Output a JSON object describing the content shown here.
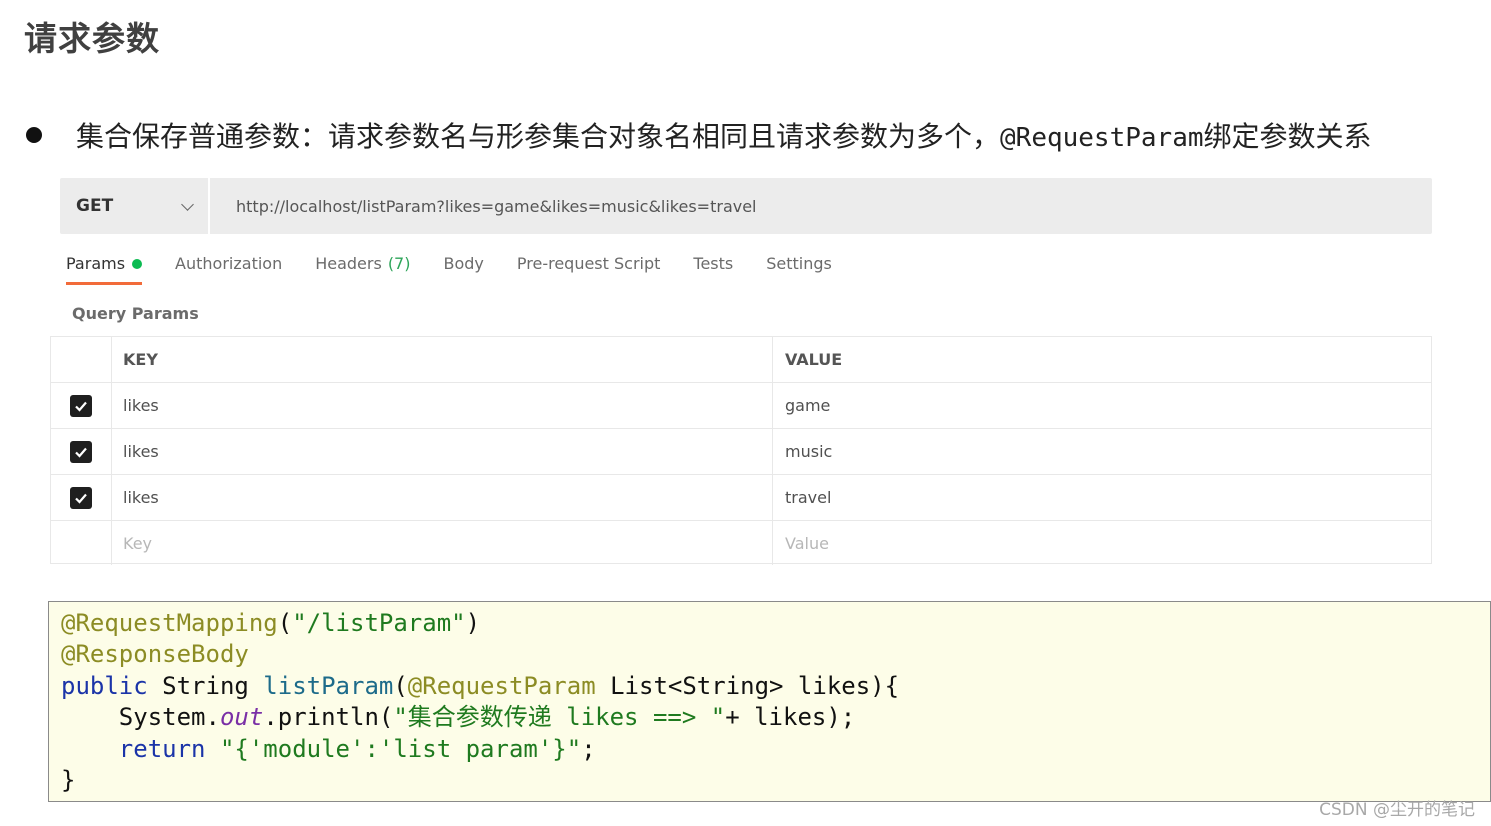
{
  "slide": {
    "title": "请求参数",
    "bullet": "集合保存普通参数：请求参数名与形参集合对象名相同且请求参数为多个，",
    "bullet_mono": "@RequestParam",
    "bullet_tail": "绑定参数关系"
  },
  "request": {
    "method": "GET",
    "url": "http://localhost/listParam?likes=game&likes=music&likes=travel"
  },
  "tabs": [
    {
      "label": "Params",
      "active": true
    },
    {
      "label": "Authorization"
    },
    {
      "label": "Headers",
      "count": "(7)"
    },
    {
      "label": "Body"
    },
    {
      "label": "Pre-request Script"
    },
    {
      "label": "Tests"
    },
    {
      "label": "Settings"
    }
  ],
  "query_params": {
    "label": "Query Params",
    "headers": {
      "key": "KEY",
      "value": "VALUE"
    },
    "rows": [
      {
        "key": "likes",
        "value": "game",
        "checked": true
      },
      {
        "key": "likes",
        "value": "music",
        "checked": true
      },
      {
        "key": "likes",
        "value": "travel",
        "checked": true
      }
    ],
    "placeholder": {
      "key": "Key",
      "value": "Value"
    }
  },
  "code": {
    "l1_ann": "@RequestMapping",
    "l1_rest": "(",
    "l1_str": "\"/listParam\"",
    "l1_end": ")",
    "l2_ann": "@ResponseBody",
    "l3_kw": "public",
    "l3_type": " String ",
    "l3_fn": "listParam",
    "l3_open": "(",
    "l3_ann": "@RequestParam",
    "l3_rest": " List<String> likes){",
    "l4_indent": "    System.",
    "l4_fld": "out",
    "l4_call": ".println(",
    "l4_str": "\"集合参数传递 likes ==> \"",
    "l4_rest": "+ likes);",
    "l5_kw": "    return",
    "l5_sp": " ",
    "l5_str": "\"{'module':'list param'}\"",
    "l5_end": ";",
    "l6": "}"
  },
  "watermark": "CSDN @尘开的笔记"
}
